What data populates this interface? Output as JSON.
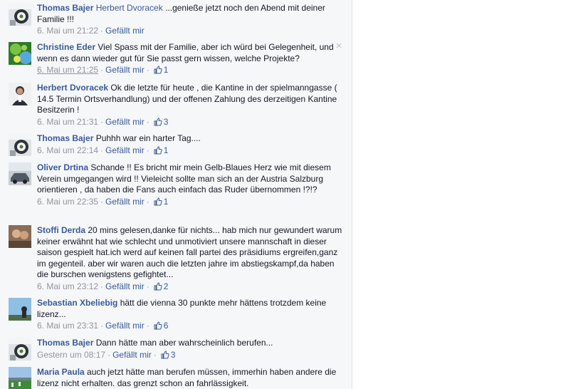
{
  "like_label": "Gefällt mir",
  "close_glyph": "×",
  "comments": [
    {
      "author": "Thomas Bajer",
      "mention": "Herbert Dvoracek",
      "text": " ...genieße jetzt noch den Abend mit deiner Familie !!!",
      "time": "6. Mai um 21:22",
      "likes": null
    },
    {
      "author": "Christine Eder",
      "mention": "",
      "text": " Viel Spass mit der Familie, aber ich würd bei Gelegenheit, und wenn es dann wieder gut für Sie passt gern wissen, welche Projekte?",
      "time": "6. Mai um 21:25",
      "likes": "1"
    },
    {
      "author": "Herbert Dvoracek",
      "mention": "",
      "text": " Ok die letzte für heute , die Kantine in der spielmanngasse ( 14.5 Termin Ortsverhandlung) und der offenen Zahlung des derzeitigen Kantine Besitzerin !",
      "time": "6. Mai um 21:31",
      "likes": "3"
    },
    {
      "author": "Thomas Bajer",
      "mention": "",
      "text": " Puhhh war ein harter Tag....",
      "time": "6. Mai um 22:14",
      "likes": "1"
    },
    {
      "author": "Oliver Drtina",
      "mention": "",
      "text": " Schande !! Es bricht mir mein Gelb-Blaues Herz wie mit diesem Verein umgegangen wird !! Vieleicht sollte man sich an der Austria Salzburg orientieren , da haben die Fans auch einfach das Ruder übernommen !?!?",
      "time": "6. Mai um 22:35",
      "likes": "1"
    },
    {
      "author": "Stoffi Derda",
      "mention": "",
      "text": " 20 mins gelesen,danke für nichts... hab mich nur gewundert warum keiner erwähnt hat wie schlecht und unmotiviert unsere mannschaft in dieser saison gespielt hat.ich werd auf keinen fall partei des präsidiums ergreifen,ganz im gegenteil. aber wir waren auch die letzten jahre im abstiegskampf,da haben die burschen wenigstens gefightet...",
      "time": "6. Mai um 23:12",
      "likes": "2"
    },
    {
      "author": "Sebastian Xbeliebig",
      "mention": "",
      "text": " hätt die vienna 30 punkte mehr hättens trotzdem keine lizenz...",
      "time": "6. Mai um 23:31",
      "likes": "6"
    },
    {
      "author": "Thomas Bajer",
      "mention": "",
      "text": " Dann hätte man aber wahrscheinlich berufen...",
      "time": "Gestern um 08:17",
      "likes": "3"
    },
    {
      "author": "Maria Paula",
      "mention": "",
      "text": " auch jetzt hätte man berufen müssen, immerhin haben andere die lizenz nicht erhalten. das grenzt schon an fahrlässigkeit.",
      "time": "",
      "likes": null
    }
  ]
}
